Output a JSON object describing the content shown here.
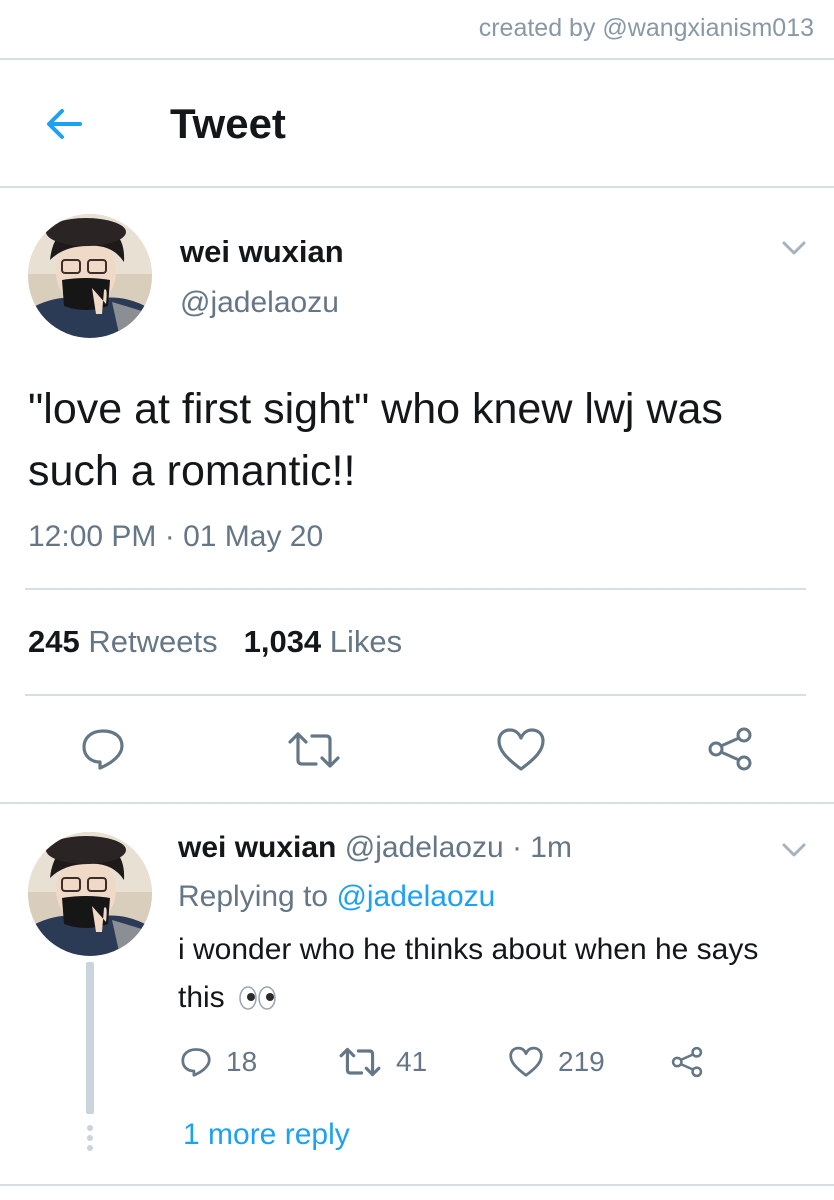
{
  "credit": "created by @wangxianism013",
  "header": {
    "title": "Tweet"
  },
  "tweet": {
    "name": "wei wuxian",
    "handle": "@jadelaozu",
    "text": "\"love at first sight\" who knew lwj was such a romantic!!",
    "timestamp": "12:00 PM · 01 May 20",
    "retweets_count": "245",
    "retweets_label": "Retweets",
    "likes_count": "1,034",
    "likes_label": "Likes"
  },
  "reply": {
    "name": "wei wuxian",
    "handle": "@jadelaozu",
    "time": "· 1m",
    "replying_prefix": "Replying to",
    "replying_to": "@jadelaozu",
    "text": "i wonder who he thinks about when he says this",
    "replies": "18",
    "retweets": "41",
    "likes": "219",
    "more_replies": "1 more reply"
  },
  "colors": {
    "accent": "#1da1f2",
    "secondary_text": "#657786",
    "divider": "#d8dee3"
  },
  "icons": [
    "back-arrow-icon",
    "chevron-down-icon",
    "reply-icon",
    "retweet-icon",
    "like-icon",
    "share-icon",
    "eyes-emoji-icon"
  ]
}
